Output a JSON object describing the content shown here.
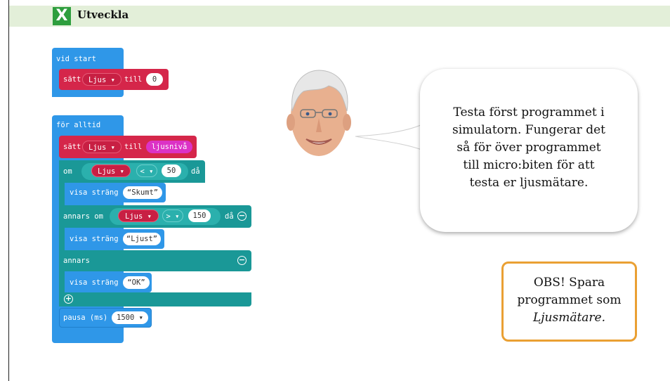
{
  "header": {
    "logo_letter": "X",
    "title": "Utveckla"
  },
  "code": {
    "on_start": "vid start",
    "set_kw": "sätt",
    "var_name": "Ljus",
    "till_kw": "till",
    "start_value": "0",
    "forever": "för alltid",
    "light_level": "ljusnivå",
    "if_kw": "om",
    "then_kw": "då",
    "lt_op": "<",
    "gt_op": ">",
    "num_50": "50",
    "num_150": "150",
    "show_string": "visa sträng",
    "str_skumt": "Skumt",
    "else_if": "annars om",
    "str_ljust": "Ljust",
    "else_kw": "annars",
    "str_ok": "OK",
    "pause_kw": "pausa (ms)",
    "pause_value": "1500"
  },
  "speech": {
    "lines": [
      "Testa först programmet i",
      "simulatorn. Fungerar det",
      "så för över programmet",
      "till micro:biten för att",
      "testa er ljusmätare."
    ]
  },
  "notice": {
    "line1": "OBS! Spara",
    "line2": "programmet som",
    "line3": "Ljusmätare."
  },
  "colors": {
    "loop_blue": "#2f97e8",
    "var_red": "#d5264a",
    "logic_teal": "#1a9897",
    "input_pink": "#dc32c6",
    "notice_border": "#eaa033",
    "header_bar": "#e3efd9",
    "logo_green": "#2e9e3e"
  },
  "icons": {
    "dropdown": "caret-down-icon",
    "remove": "minus-circle-icon",
    "add": "plus-circle-icon"
  }
}
